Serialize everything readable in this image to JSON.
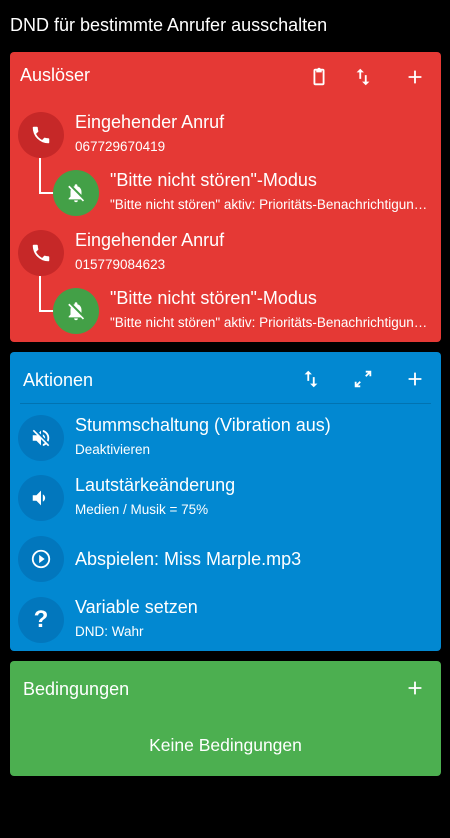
{
  "window_title": "DND für bestimmte Anrufer ausschalten",
  "colors": {
    "triggers": "#e53935",
    "actions": "#0288d1",
    "conditions": "#4caf50",
    "background": "#000000"
  },
  "triggers": {
    "title": "Auslöser",
    "header_icons": [
      "clipboard-icon",
      "sort-icon",
      "add-icon"
    ],
    "items": [
      {
        "title": "Eingehender Anruf",
        "subtitle": "067729670419",
        "icon": "phone-icon",
        "constraint": {
          "title": "\"Bitte nicht stören\"-Modus",
          "subtitle": "\"Bitte nicht stören\" aktiv: Prioritäts-Benachrichtigungen",
          "icon": "dnd-bell-icon"
        }
      },
      {
        "title": "Eingehender Anruf",
        "subtitle": "015779084623",
        "icon": "phone-icon",
        "constraint": {
          "title": "\"Bitte nicht stören\"-Modus",
          "subtitle": "\"Bitte nicht stören\" aktiv: Prioritäts-Benachrichtigungen",
          "icon": "dnd-bell-icon"
        }
      }
    ]
  },
  "actions": {
    "title": "Aktionen",
    "header_icons": [
      "sort-icon",
      "expand-icon",
      "add-icon"
    ],
    "items": [
      {
        "title": "Stummschaltung (Vibration aus)",
        "subtitle": "Deaktivieren",
        "icon": "mute-icon"
      },
      {
        "title": "Lautstärkeänderung",
        "subtitle": "Medien / Musik = 75%",
        "icon": "volume-icon"
      },
      {
        "title": "Abspielen: Miss Marple.mp3",
        "subtitle": "",
        "icon": "play-icon"
      },
      {
        "title": "Variable setzen",
        "subtitle": "DND: Wahr",
        "icon": "question-icon",
        "glyph": "?"
      }
    ]
  },
  "conditions": {
    "title": "Bedingungen",
    "header_icons": [
      "add-icon"
    ],
    "empty_text": "Keine Bedingungen"
  }
}
